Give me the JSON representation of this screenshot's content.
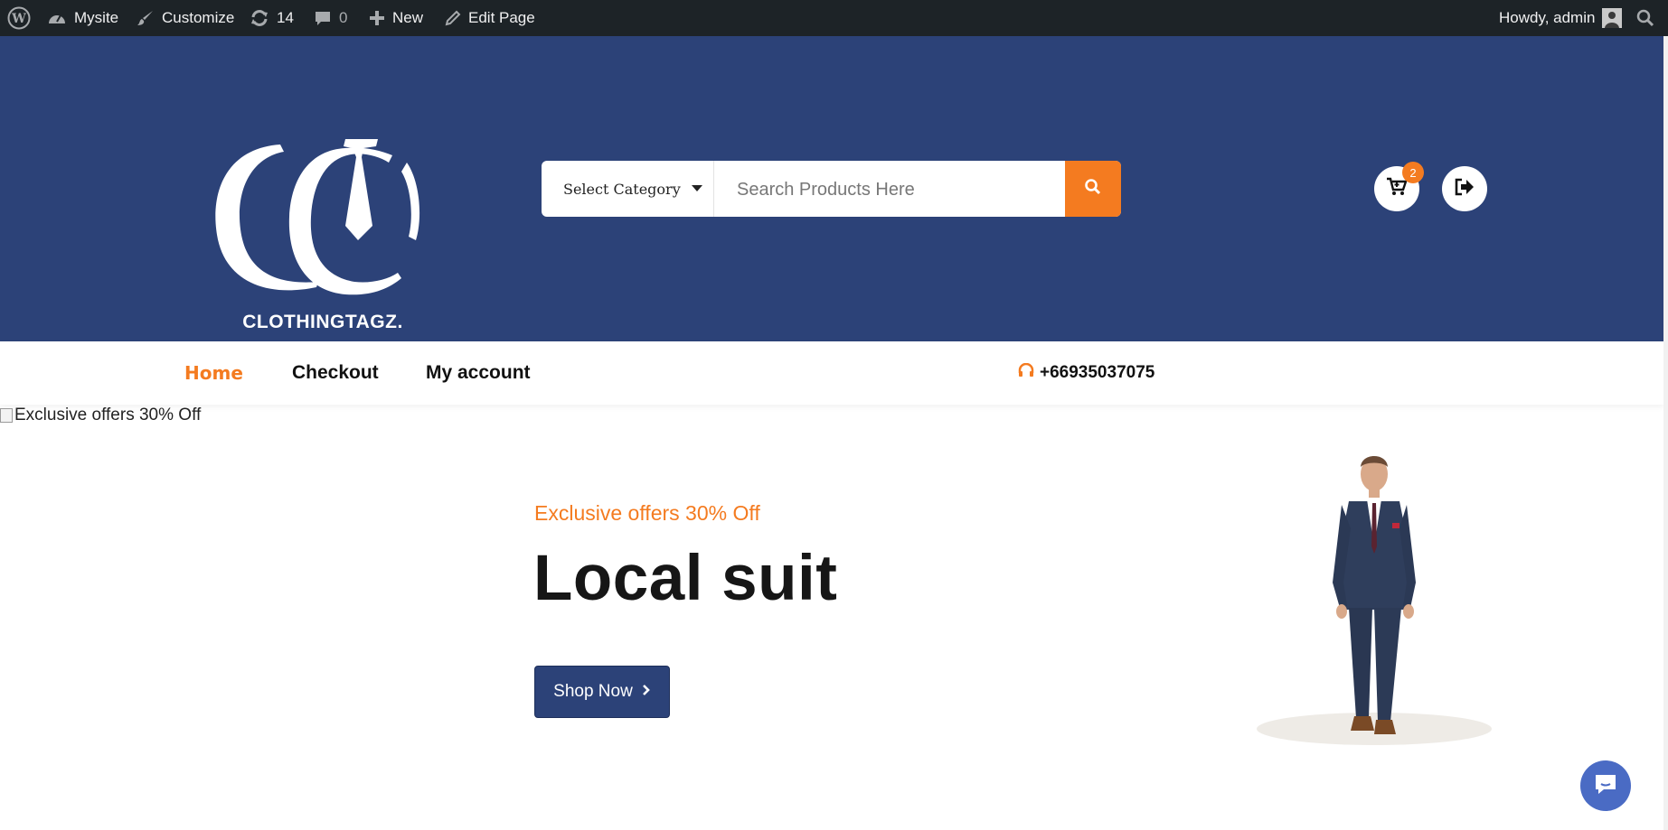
{
  "admin_bar": {
    "site_name": "Mysite",
    "customize": "Customize",
    "updates_count": "14",
    "comments_count": "0",
    "new_label": "New",
    "edit_page": "Edit Page",
    "howdy": "Howdy, admin"
  },
  "header": {
    "logo_text": "CLOTHINGTAGZ.",
    "category_select": "Select Category",
    "search_placeholder": "Search Products Here",
    "cart_count": "2"
  },
  "nav": {
    "items": [
      "Home",
      "Checkout",
      "My account"
    ],
    "active": "Home",
    "phone": "+66935037075"
  },
  "hero": {
    "broken_image_alt": "Exclusive offers 30% Off",
    "subtitle": "Exclusive offers 30% Off",
    "title": "Local suit",
    "button_label": "Shop Now"
  },
  "colors": {
    "admin_bar": "#1d2327",
    "header_bg": "#2c4278",
    "accent": "#f47b20",
    "button_bg": "#2c4278",
    "chat_button": "#4a6bc4"
  },
  "icons": {
    "admin_bar": [
      "wordpress-icon",
      "dashboard-icon",
      "brush-icon",
      "update-icon",
      "comment-icon",
      "plus-icon",
      "pencil-icon",
      "avatar",
      "search-icon"
    ],
    "header": [
      "search-icon",
      "cart-icon",
      "logout-icon"
    ],
    "nav": [
      "headset-icon"
    ],
    "hero": [
      "chevron-right-icon"
    ],
    "floating": [
      "chat-icon"
    ]
  }
}
